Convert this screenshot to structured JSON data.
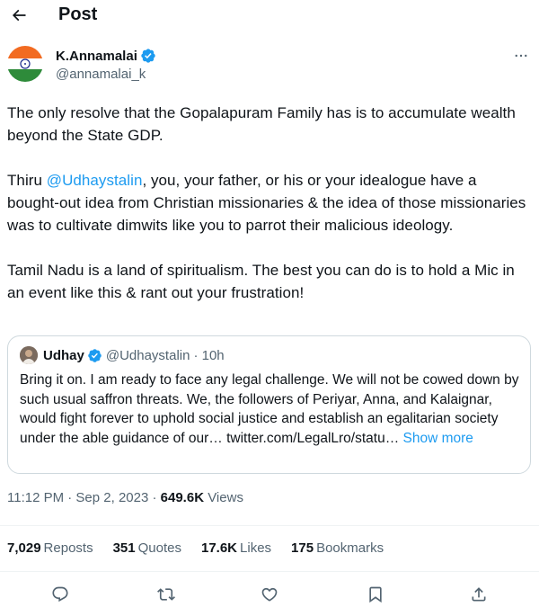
{
  "header": {
    "title": "Post",
    "back_icon": "arrow-left-icon"
  },
  "author": {
    "name": "K.Annamalai",
    "handle": "@annamalai_k",
    "verified": true
  },
  "tweet": {
    "p1": "The only resolve that the Gopalapuram Family has is to accumulate wealth beyond the State GDP.",
    "p2_pre": "Thiru ",
    "p2_mention": "@Udhaystalin",
    "p2_post": ", you, your father, or his or your idealogue have a bought-out idea from Christian missionaries & the idea of those missionaries was to cultivate dimwits like you to parrot their malicious ideology.",
    "p3": "Tamil Nadu is a land of spiritualism. The best you can do is to hold a Mic in an event like this & rant out your frustration!"
  },
  "quote": {
    "name": "Udhay",
    "handle": "@Udhaystalin",
    "time": "· 10h",
    "text": "Bring it on. I am ready to face any legal challenge. We will not be cowed down by such usual saffron threats. We, the followers of Periyar, Anna, and Kalaignar, would fight forever to uphold social justice and establish an egalitarian society under the able guidance of our… twitter.com/LegalLro/statu…",
    "show_more": "Show more"
  },
  "meta": {
    "time": "11:12 PM · Sep 2, 2023 · ",
    "views_count": "649.6K",
    "views_label": " Views"
  },
  "stats": {
    "reposts_count": "7,029",
    "reposts_label": "Reposts",
    "quotes_count": "351",
    "quotes_label": "Quotes",
    "likes_count": "17.6K",
    "likes_label": "Likes",
    "bookmarks_count": "175",
    "bookmarks_label": "Bookmarks"
  },
  "colors": {
    "accent": "#1d9bf0",
    "text": "#0f1419",
    "muted": "#536471",
    "border": "#cfd9de"
  }
}
